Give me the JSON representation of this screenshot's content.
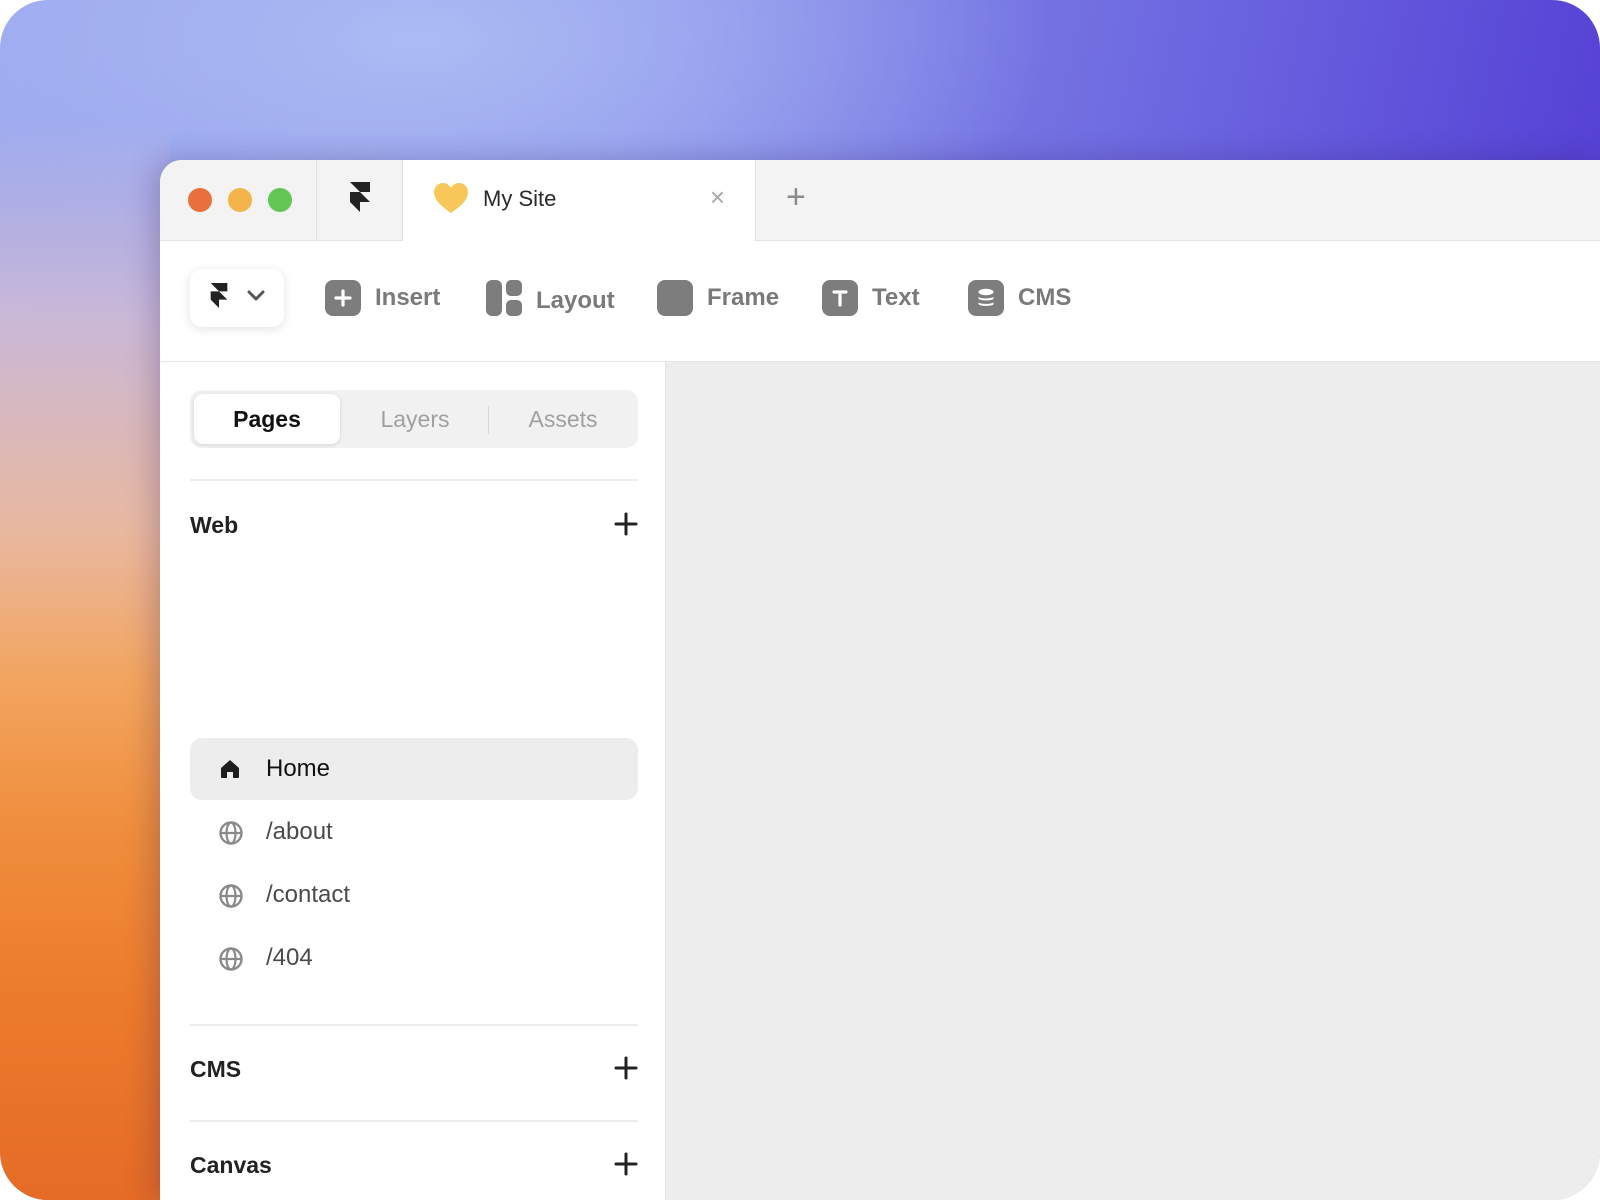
{
  "colors": {
    "accent_purple": "#4a2fd0",
    "accent_orange": "#ec7a2c",
    "traffic_red": "#e7703c",
    "traffic_yellow": "#f3b44b",
    "traffic_green": "#62c554",
    "tool_icon_gray": "#7d7d7d"
  },
  "tabbar": {
    "tab_title": "My Site",
    "tab_icon": "heart-icon",
    "close_glyph": "×",
    "add_glyph": "+"
  },
  "toolbar": {
    "tools": [
      {
        "label": "Insert",
        "icon": "plus-square-icon"
      },
      {
        "label": "Layout",
        "icon": "layout-icon"
      },
      {
        "label": "Frame",
        "icon": "frame-icon"
      },
      {
        "label": "Text",
        "icon": "text-icon"
      },
      {
        "label": "CMS",
        "icon": "database-icon"
      }
    ]
  },
  "sidebar": {
    "tabs": [
      {
        "label": "Pages",
        "active": true
      },
      {
        "label": "Layers",
        "active": false
      },
      {
        "label": "Assets",
        "active": false
      }
    ],
    "sections": [
      {
        "title": "Web"
      },
      {
        "title": "CMS"
      },
      {
        "title": "Canvas"
      }
    ],
    "pages": [
      {
        "label": "Home",
        "icon": "home-icon",
        "active": true
      },
      {
        "label": "/about",
        "icon": "globe-icon",
        "active": false
      },
      {
        "label": "/contact",
        "icon": "globe-icon",
        "active": false
      },
      {
        "label": "/404",
        "icon": "globe-icon",
        "active": false
      }
    ]
  }
}
